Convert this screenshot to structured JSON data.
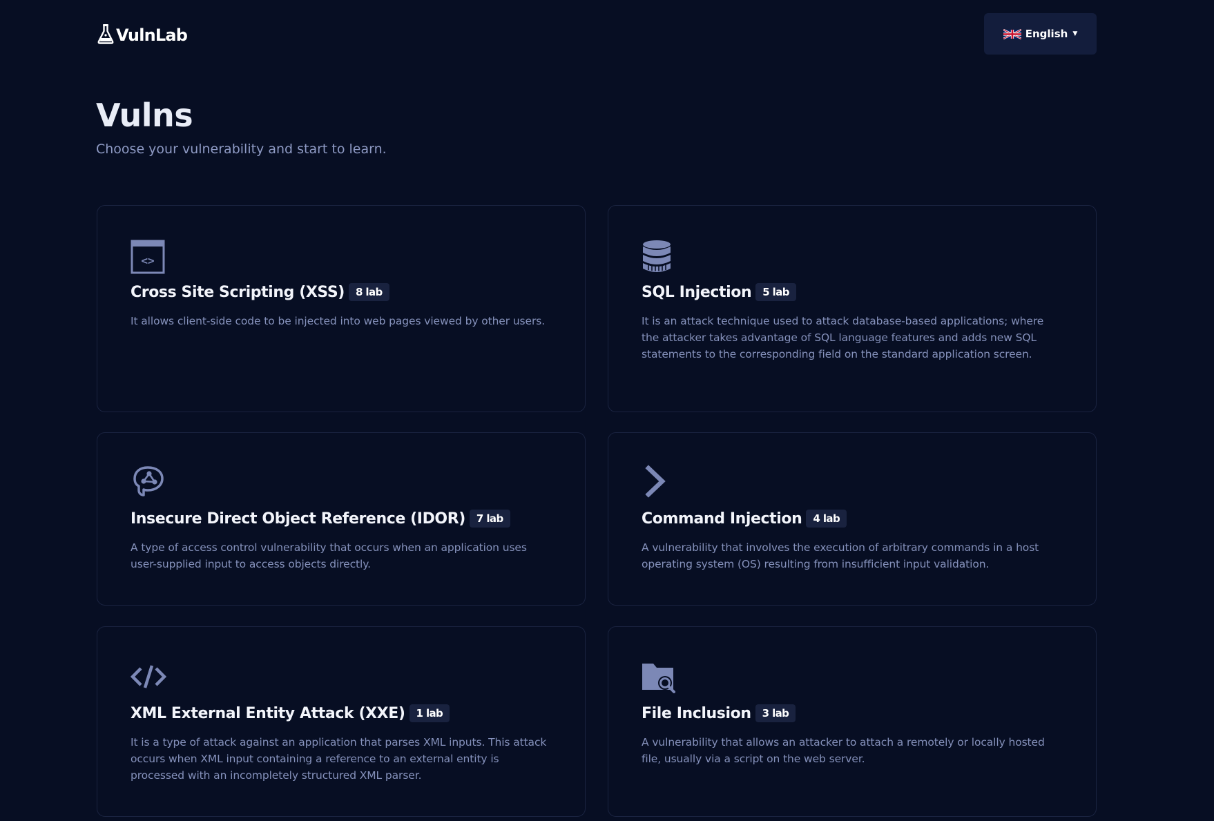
{
  "header": {
    "logo_text": "VulnLab",
    "language_label": "English"
  },
  "page": {
    "title": "Vulns",
    "subtitle": "Choose your vulnerability and start to learn."
  },
  "colors": {
    "background": "#070e23",
    "card_border": "#1a2340",
    "icon": "#7c88b6",
    "badge_bg": "#19223f",
    "button_bg": "#131d3c"
  },
  "vulns": [
    {
      "icon": "code-window-icon",
      "title": "Cross Site Scripting (XSS)",
      "badge": "8 lab",
      "description": "It allows client-side code to be injected into web pages viewed by other users."
    },
    {
      "icon": "database-icon",
      "title": "SQL Injection",
      "badge": "5 lab",
      "description": "It is an attack technique used to attack database-based applications; where the attacker takes advantage of SQL language features and adds new SQL statements to the corresponding field on the standard application screen."
    },
    {
      "icon": "brain-icon",
      "title": "Insecure Direct Object Reference (IDOR)",
      "badge": "7 lab",
      "description": "A type of access control vulnerability that occurs when an application uses user-supplied input to access objects directly."
    },
    {
      "icon": "chevron-right-icon",
      "title": "Command Injection",
      "badge": "4 lab",
      "description": "A vulnerability that involves the execution of arbitrary commands in a host operating system (OS) resulting from insufficient input validation."
    },
    {
      "icon": "code-tag-icon",
      "title": "XML External Entity Attack (XXE)",
      "badge": "1 lab",
      "description": "It is a type of attack against an application that parses XML inputs. This attack occurs when XML input containing a reference to an external entity is processed with an incompletely structured XML parser."
    },
    {
      "icon": "folder-search-icon",
      "title": "File Inclusion",
      "badge": "3 lab",
      "description": "A vulnerability that allows an attacker to attach a remotely or locally hosted file, usually via a script on the web server."
    }
  ]
}
